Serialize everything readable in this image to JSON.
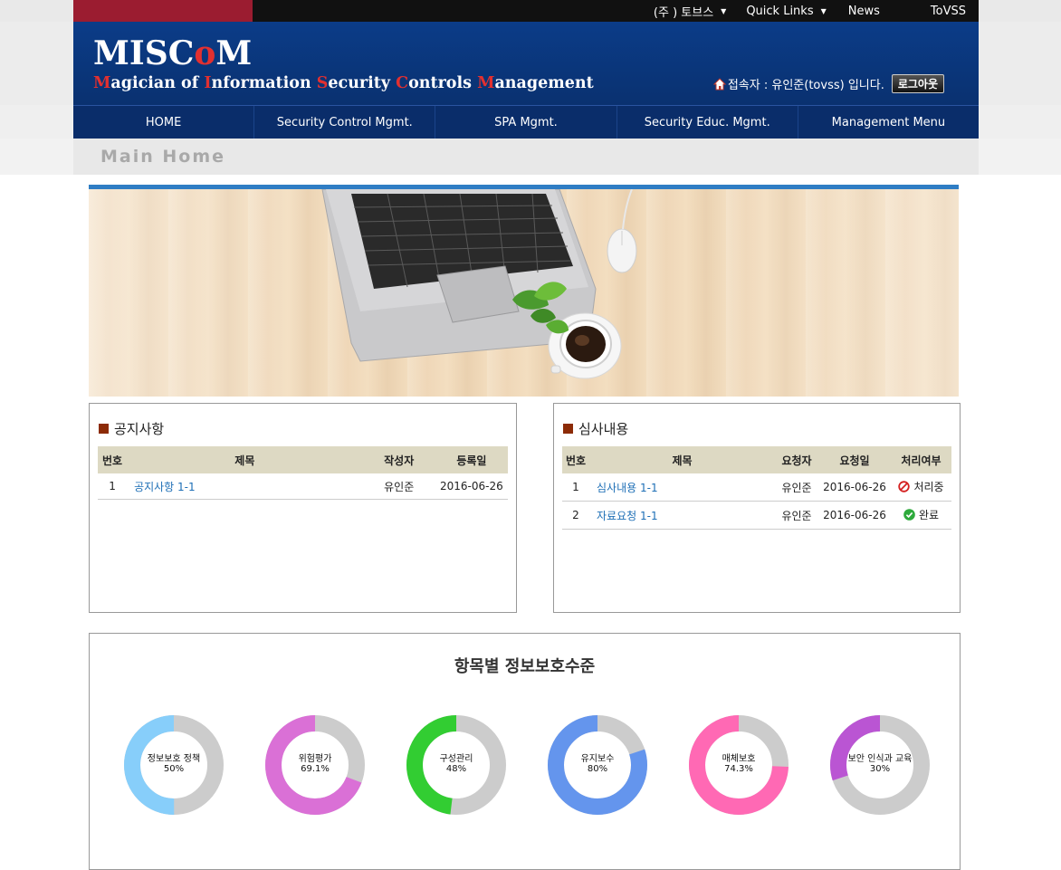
{
  "topbar": {
    "links": [
      {
        "label": "(주 ) 토브스",
        "caret": true
      },
      {
        "label": "Quick Links",
        "caret": true
      },
      {
        "label": "News",
        "caret": false
      },
      {
        "label": "ToVSS",
        "caret": false
      }
    ]
  },
  "header": {
    "logo_parts": [
      "MISC",
      "o",
      "M"
    ],
    "logo_sub": [
      {
        "cap": "M",
        "rest": "agician of "
      },
      {
        "cap": "I",
        "rest": "nformation "
      },
      {
        "cap": "S",
        "rest": "ecurity "
      },
      {
        "cap": "C",
        "rest": "ontrols "
      },
      {
        "cap": "M",
        "rest": "anagement"
      }
    ],
    "user_text": "접속자 : 유인준(tovss) 입니다.",
    "logout_label": "로그아웃"
  },
  "nav": [
    "HOME",
    "Security Control Mgmt.",
    "SPA Mgmt.",
    "Security Educ. Mgmt.",
    "Management Menu"
  ],
  "subheader": {
    "title": "Main Home"
  },
  "notice": {
    "title": "공지사항",
    "headers": [
      "번호",
      "제목",
      "작성자",
      "등록일"
    ],
    "rows": [
      {
        "no": "1",
        "title": "공지사항 1-1",
        "author": "유인준",
        "date": "2016-06-26"
      }
    ]
  },
  "review": {
    "title": "심사내용",
    "headers": [
      "번호",
      "제목",
      "요청자",
      "요청일",
      "처리여부"
    ],
    "rows": [
      {
        "no": "1",
        "title": "심사내용 1-1",
        "requester": "유인준",
        "date": "2016-06-26",
        "status": "처리중",
        "status_icon": "prohibited-icon"
      },
      {
        "no": "2",
        "title": "자료요청 1-1",
        "requester": "유인준",
        "date": "2016-06-26",
        "status": "완료",
        "status_icon": "check-circle-icon"
      }
    ]
  },
  "chart_data": {
    "type": "pie",
    "title": "항목별 정보보호수준",
    "series": [
      {
        "name": "정보보호 정책",
        "value": 50,
        "label": "50%",
        "color": "#87cefa"
      },
      {
        "name": "위험평가",
        "value": 69.1,
        "label": "69.1%",
        "color": "#da70d6"
      },
      {
        "name": "구성관리",
        "value": 48,
        "label": "48%",
        "color": "#32cd32"
      },
      {
        "name": "유지보수",
        "value": 80,
        "label": "80%",
        "color": "#6495ed"
      },
      {
        "name": "매체보호",
        "value": 74.3,
        "label": "74.3%",
        "color": "#ff69b4"
      },
      {
        "name": "보안 인식과 교육",
        "value": 30,
        "label": "30%",
        "color": "#ba55d3"
      }
    ],
    "remainder_color": "#cccccc"
  }
}
